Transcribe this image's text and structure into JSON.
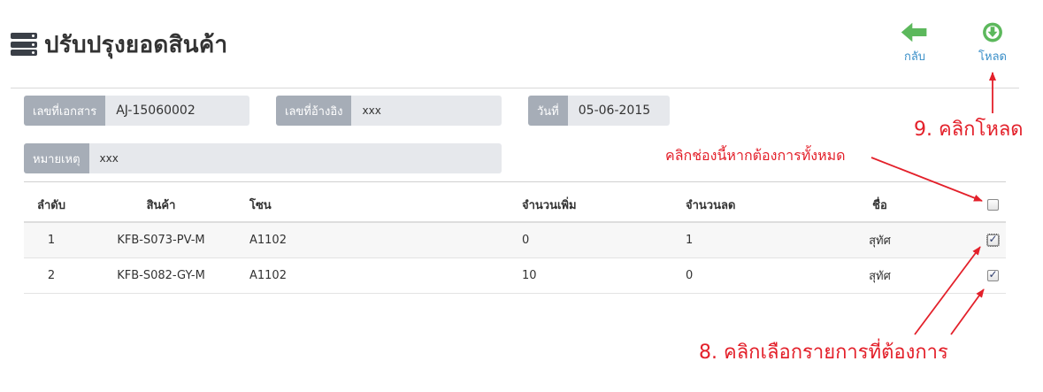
{
  "header": {
    "title": "ปรับปรุงยอดสินค้า",
    "icon": "list-icon"
  },
  "toolbar": {
    "back_label": "กลับ",
    "download_label": "โหลด",
    "colors": {
      "back": "#5cb85c",
      "download": "#5cb85c",
      "label": "#3a8fc8"
    }
  },
  "form": {
    "doc_no": {
      "label": "เลขที่เอกสาร",
      "value": "AJ-15060002"
    },
    "ref_no": {
      "label": "เลขที่อ้างอิง",
      "value": "xxx"
    },
    "date": {
      "label": "วันที่",
      "value": "05-06-2015"
    },
    "note": {
      "label": "หมายเหตุ",
      "value": "xxx"
    }
  },
  "table": {
    "columns": [
      "ลำดับ",
      "สินค้า",
      "โซน",
      "จำนวนเพิ่ม",
      "จำนวนลด",
      "ชื่อ"
    ],
    "select_all_checked": false,
    "rows": [
      {
        "no": "1",
        "product": "KFB-S073-PV-M",
        "zone": "A1102",
        "increase": "0",
        "decrease": "1",
        "name": "สุทัศ",
        "checked": true
      },
      {
        "no": "2",
        "product": "KFB-S082-GY-M",
        "zone": "A1102",
        "increase": "10",
        "decrease": "0",
        "name": "สุทัศ",
        "checked": true
      }
    ]
  },
  "annotations": {
    "step9": "9. คลิกโหลด",
    "select_all": "คลิกช่องนี้หากต้องการทั้งหมด",
    "step8": "8. คลิกเลือกรายการที่ต้องการ",
    "color": "#e3202a"
  }
}
